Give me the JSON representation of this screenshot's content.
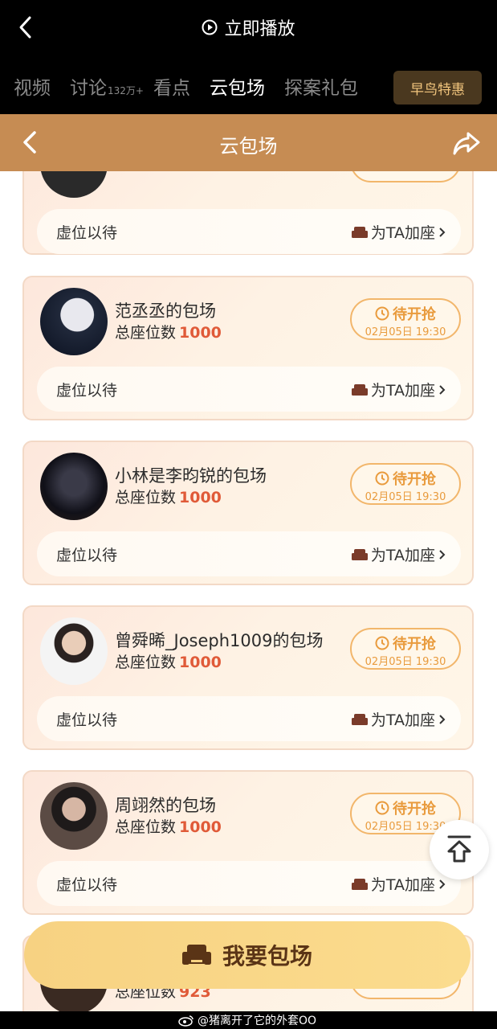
{
  "top": {
    "play_label": "立即播放",
    "tabs": [
      {
        "label": "视频",
        "active": false
      },
      {
        "label": "讨论",
        "badge": "132万+",
        "active": false
      },
      {
        "label": "看点",
        "active": false
      },
      {
        "label": "云包场",
        "active": true
      },
      {
        "label": "探案礼包",
        "active": false
      }
    ],
    "early_bird": "早鸟特惠"
  },
  "sub_header": {
    "title": "云包场"
  },
  "colors": {
    "accent": "#c68c53",
    "seat_number": "#e05a38",
    "pill": "#e99b3d",
    "button": "#f7d282"
  },
  "cards": [
    {
      "name": "",
      "seats_label": "总座位数",
      "seats": "",
      "wait": "虚位以待",
      "add": "为TA加座",
      "status": "",
      "time": ""
    },
    {
      "name": "范丞丞的包场",
      "seats_label": "总座位数",
      "seats": "1000",
      "wait": "虚位以待",
      "add": "为TA加座",
      "status": "待开抢",
      "time": "02月05日 19:30"
    },
    {
      "name": "小林是李昀锐的包场",
      "seats_label": "总座位数",
      "seats": "1000",
      "wait": "虚位以待",
      "add": "为TA加座",
      "status": "待开抢",
      "time": "02月05日 19:30"
    },
    {
      "name": "曾舜晞_Joseph1009的包场",
      "seats_label": "总座位数",
      "seats": "1000",
      "wait": "虚位以待",
      "add": "为TA加座",
      "status": "待开抢",
      "time": "02月05日 19:30"
    },
    {
      "name": "周翊然的包场",
      "seats_label": "总座位数",
      "seats": "1000",
      "wait": "虚位以待",
      "add": "为TA加座",
      "status": "待开抢",
      "time": "02月05日 19:30"
    },
    {
      "name": "",
      "seats_label": "总座位数",
      "seats": "923",
      "wait": "",
      "add": "",
      "status": "",
      "time": ""
    }
  ],
  "action_button": "我要包场",
  "watermark": "@猪离开了它的外套OO"
}
